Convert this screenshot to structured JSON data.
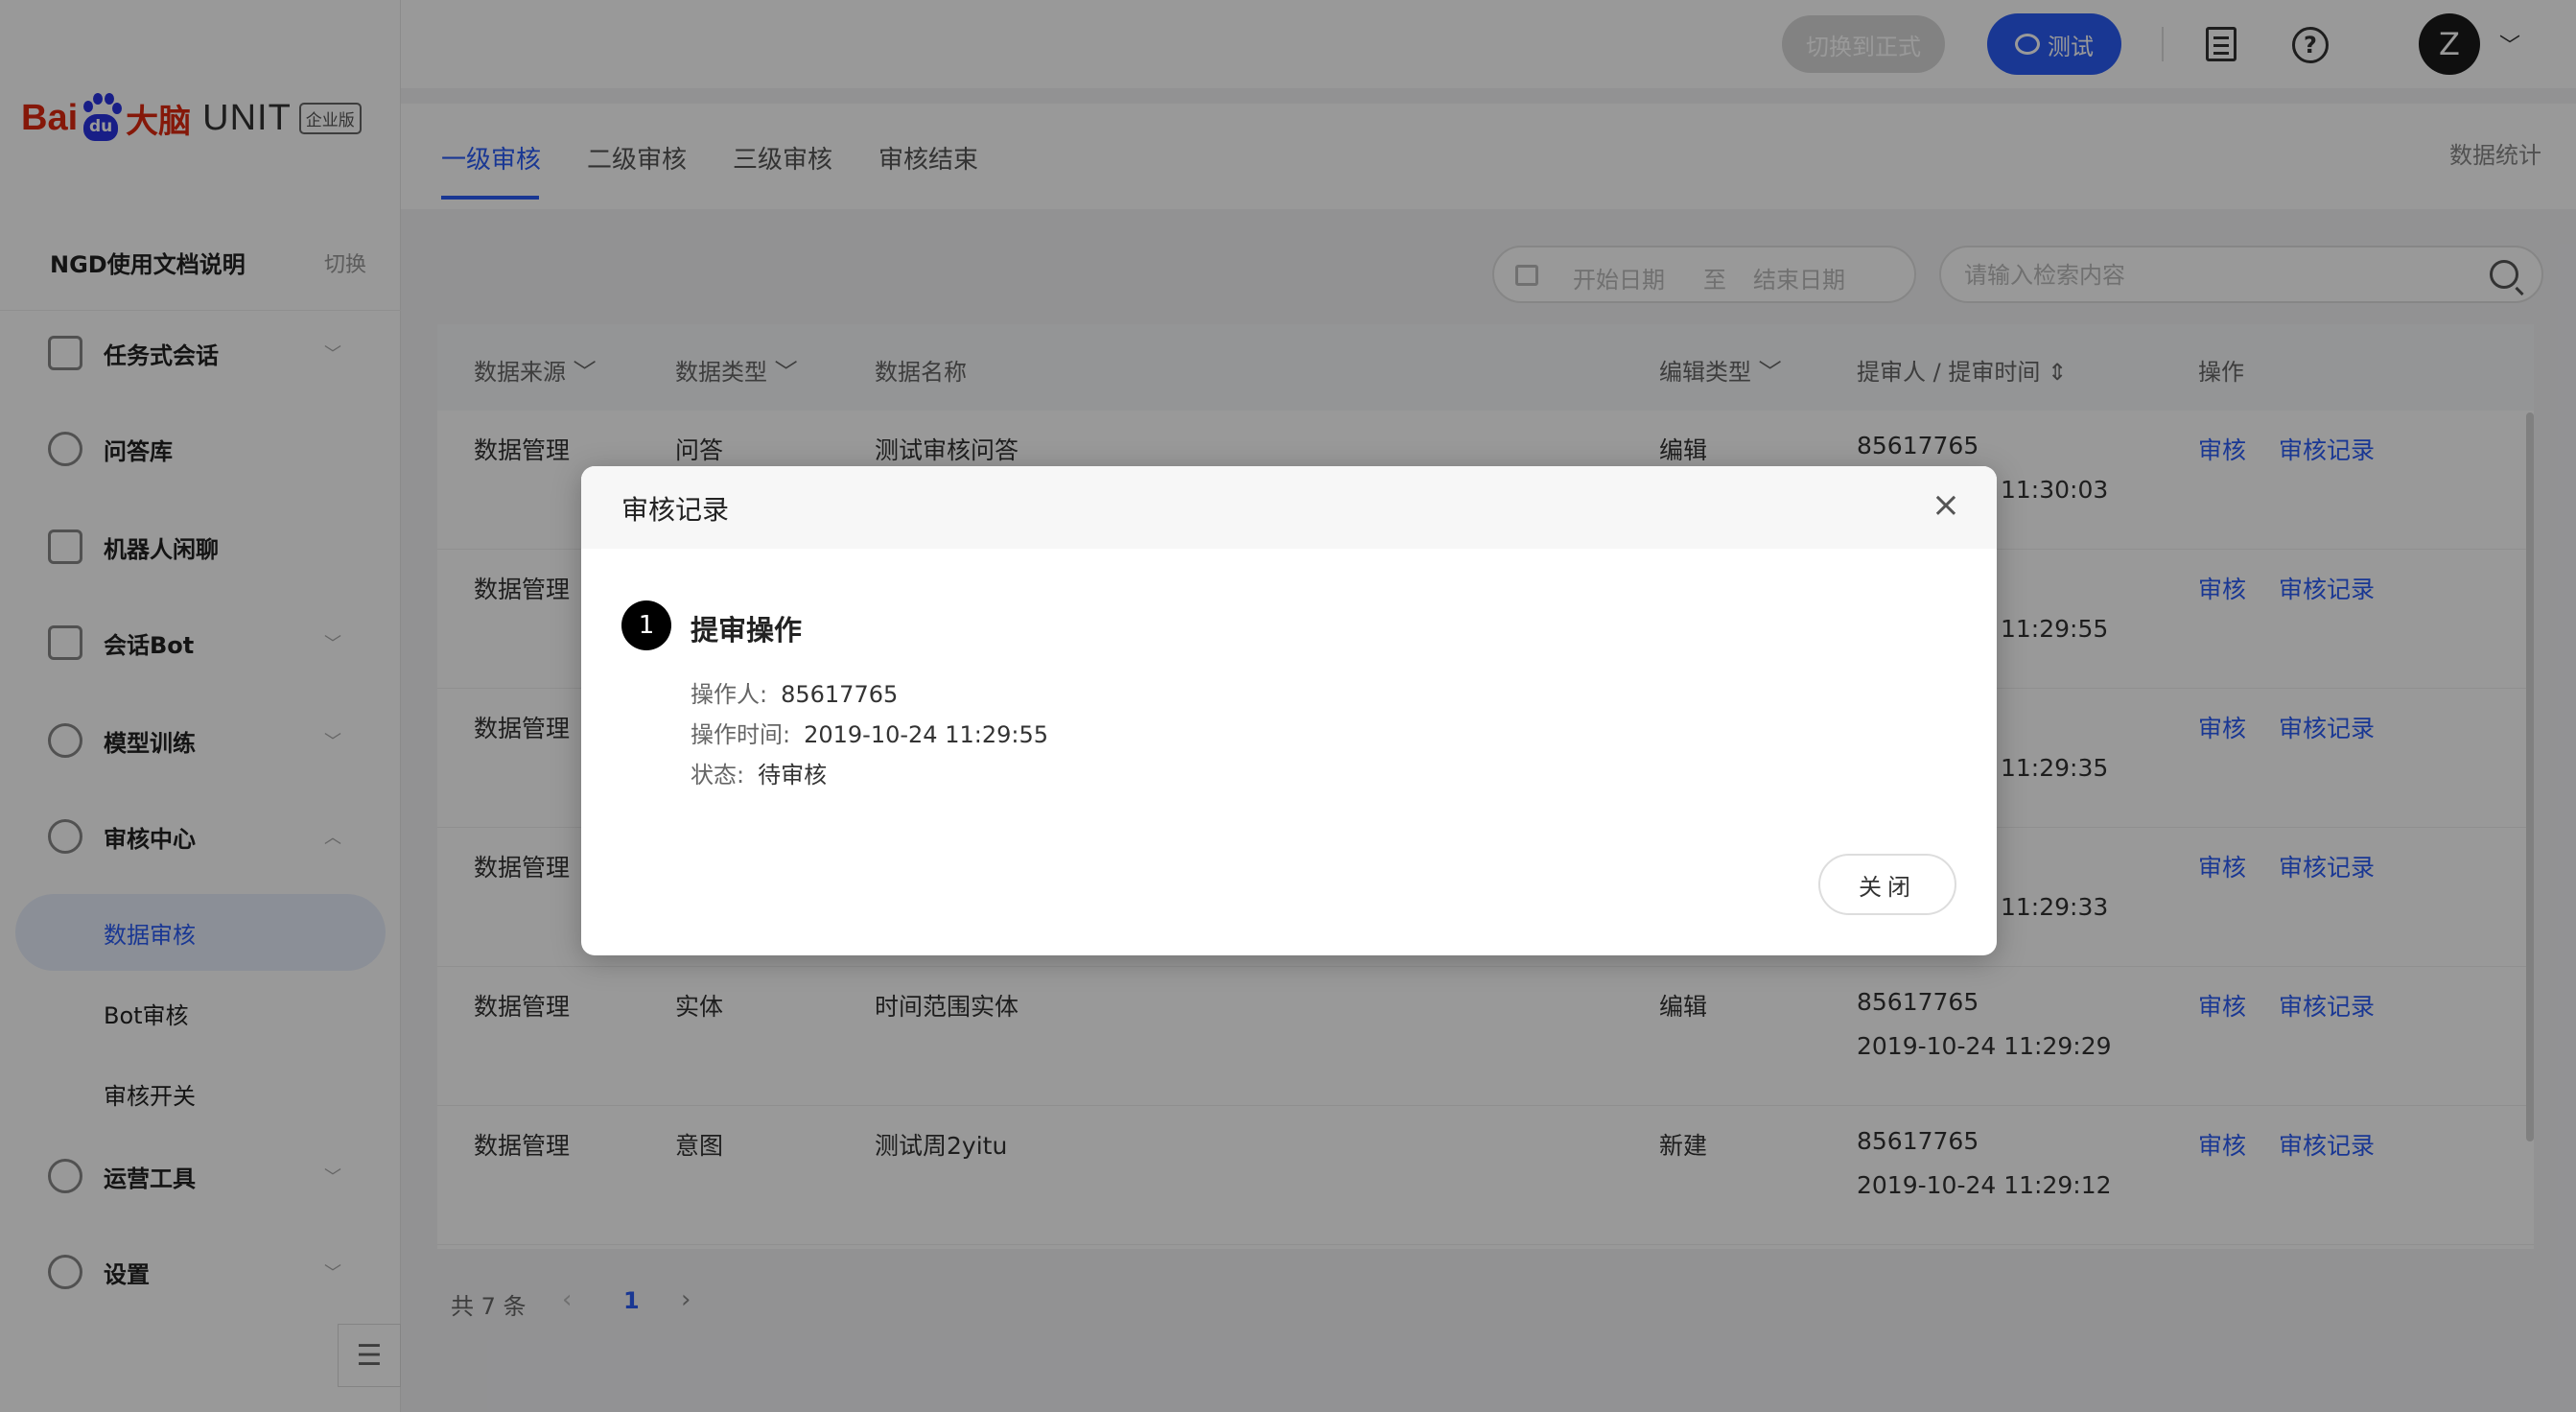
{
  "logo": {
    "bai": "Bai",
    "du": "du",
    "dn": "大脑",
    "unit": "UNIT",
    "edition": "企业版"
  },
  "project": {
    "name": "NGD使用文档说明",
    "switch": "切换"
  },
  "nav": {
    "task": "任务式会话",
    "qa": "问答库",
    "chitchat": "机器人闲聊",
    "bot": "会话Bot",
    "training": "模型训练",
    "review_center": "审核中心",
    "data_review": "数据审核",
    "bot_review": "Bot审核",
    "review_switch": "审核开关",
    "ops": "运营工具",
    "settings": "设置"
  },
  "header": {
    "formal": "切换到正式",
    "test": "测试",
    "avatar": "Z"
  },
  "tabs": {
    "level1": "一级审核",
    "level2": "二级审核",
    "level3": "三级审核",
    "done": "审核结束",
    "stats": "数据统计"
  },
  "filters": {
    "start": "开始日期",
    "to": "至",
    "end": "结束日期",
    "search_placeholder": "请输入检索内容"
  },
  "table": {
    "headers": {
      "source": "数据来源",
      "type": "数据类型",
      "name": "数据名称",
      "edit_type": "编辑类型",
      "submitter": "提审人 / 提审时间",
      "action": "操作"
    },
    "rows": [
      {
        "source": "数据管理",
        "type": "问答",
        "name": "测试审核问答",
        "edit": "编辑",
        "user": "85617765",
        "time": "11:30:03",
        "review": "审核",
        "record": "审核记录"
      },
      {
        "source": "数据管理",
        "type": "",
        "name": "",
        "edit": "",
        "user": "",
        "time": "11:29:55",
        "review": "审核",
        "record": "审核记录"
      },
      {
        "source": "数据管理",
        "type": "",
        "name": "",
        "edit": "",
        "user": "",
        "time": "11:29:35",
        "review": "审核",
        "record": "审核记录"
      },
      {
        "source": "数据管理",
        "type": "",
        "name": "",
        "edit": "",
        "user": "",
        "time": "11:29:33",
        "review": "审核",
        "record": "审核记录"
      },
      {
        "source": "数据管理",
        "type": "实体",
        "name": "时间范围实体",
        "edit": "编辑",
        "user": "85617765",
        "time": "2019-10-24 11:29:29",
        "review": "审核",
        "record": "审核记录"
      },
      {
        "source": "数据管理",
        "type": "意图",
        "name": "测试周2yitu",
        "edit": "新建",
        "user": "85617765",
        "time": "2019-10-24 11:29:12",
        "review": "审核",
        "record": "审核记录"
      }
    ]
  },
  "pager": {
    "total": "共 7 条",
    "page": "1"
  },
  "modal": {
    "title": "审核记录",
    "step_number": "1",
    "step_title": "提审操作",
    "operator_label": "操作人:",
    "operator_value": "85617765",
    "time_label": "操作时间:",
    "time_value": "2019-10-24 11:29:55",
    "status_label": "状态:",
    "status_value": "待审核",
    "close_button": "关闭"
  }
}
